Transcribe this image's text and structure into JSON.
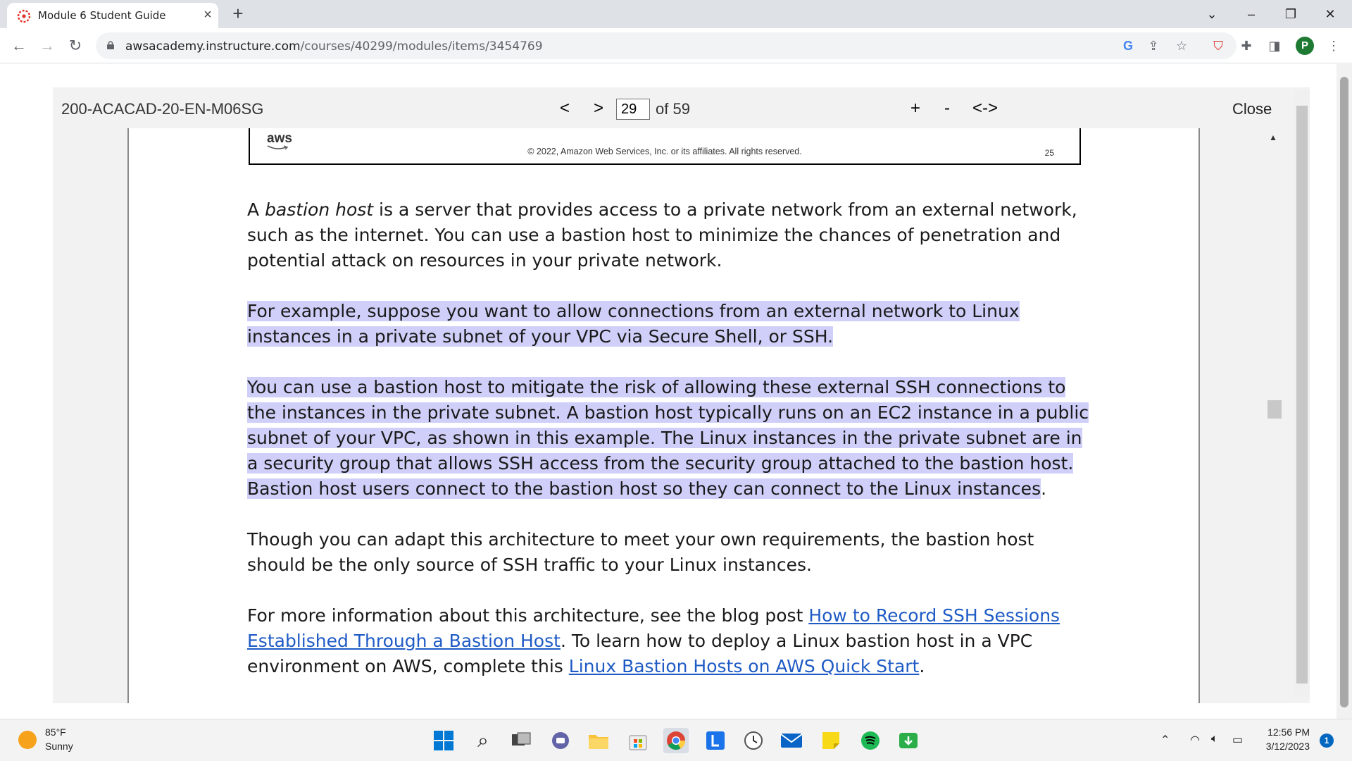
{
  "browser": {
    "tab_title": "Module 6 Student Guide",
    "url_host": "awsacademy.instructure.com",
    "url_path": "/courses/40299/modules/items/3454769",
    "colors": {
      "tabstrip": "#dee1e6",
      "omnibox": "#f1f3f4",
      "profile": "#1e7a33"
    },
    "profile_initial": "P"
  },
  "viewer": {
    "doc_id": "200-ACACAD-20-EN-M06SG",
    "prev_label": "<",
    "next_label": ">",
    "page_value": "29",
    "page_total_label": "of 59",
    "zoom_in_label": "+",
    "zoom_out_label": "-",
    "fit_label": "<->",
    "close_label": "Close"
  },
  "slide": {
    "logo_text": "aws",
    "copyright": "© 2022, Amazon Web Services, Inc. or its affiliates. All rights reserved.",
    "slide_number": "25"
  },
  "notes": {
    "p1_a": "A ",
    "p1_em": "bastion host",
    "p1_b": " is a server that provides access to a private network from an external network, such as the internet. You can use a bastion host to minimize the chances of penetration and potential attack on resources in your private network.",
    "p2": "For example, suppose you want to allow connections from an external network to Linux instances in a private subnet of your VPC via Secure Shell, or SSH.",
    "p3_hl": "You can use a bastion host to mitigate the risk of allowing these external SSH connections to the instances in the private subnet. A bastion host typically runs on an EC2 instance in a public subnet of your VPC, as shown in this example. The Linux instances in the private subnet are in a security group that allows SSH access from the security group attached to the bastion host. Bastion host users connect to the bastion host so they can connect to the Linux instances",
    "p3_end": ".",
    "p4": "Though you can adapt this architecture to meet your own requirements, the bastion host should be the only source of SSH traffic to your Linux instances.",
    "p5_a": "For more information about this architecture, see the blog post ",
    "p5_link1": "How to Record SSH Sessions Established Through a Bastion Host",
    "p5_b": ". To learn how to deploy a Linux bastion host in a VPC environment on AWS, complete this ",
    "p5_link2": "Linux Bastion Hosts on AWS Quick Start",
    "p5_c": ".",
    "highlight_color": "#cfcff9",
    "link_color": "#1f5bc5"
  },
  "taskbar": {
    "temperature": "85°F",
    "condition": "Sunny",
    "time": "12:56 PM",
    "date": "3/12/2023",
    "notification_count": "1"
  }
}
